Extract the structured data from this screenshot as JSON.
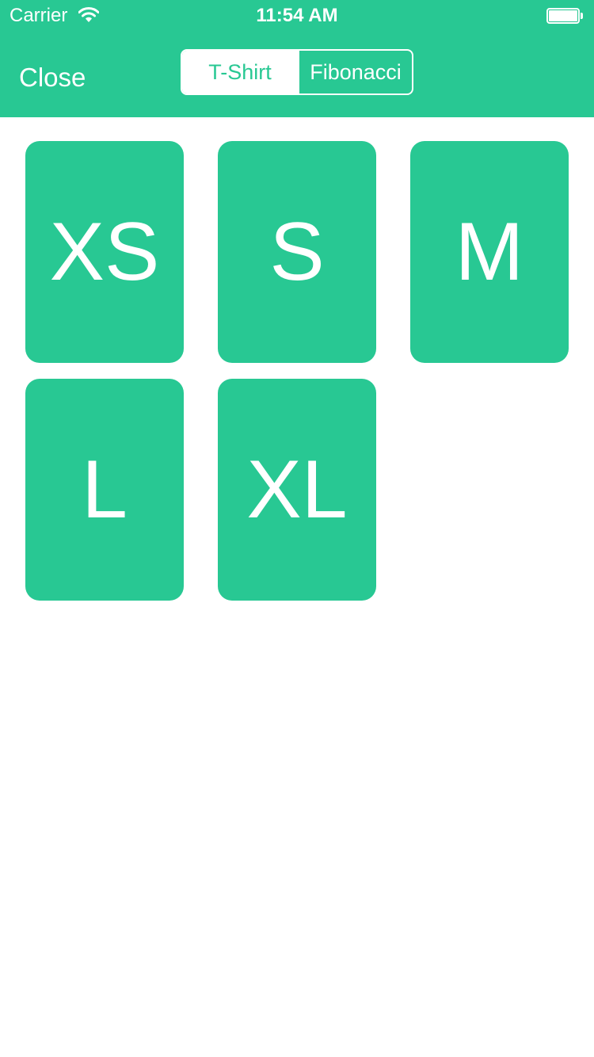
{
  "status_bar": {
    "carrier": "Carrier",
    "time": "11:54 AM",
    "battery_level": 1.0
  },
  "nav": {
    "close_label": "Close",
    "segments": [
      {
        "label": "T-Shirt",
        "selected": true
      },
      {
        "label": "Fibonacci",
        "selected": false
      }
    ]
  },
  "cards": [
    {
      "label": "XS"
    },
    {
      "label": "S"
    },
    {
      "label": "M"
    },
    {
      "label": "L"
    },
    {
      "label": "XL"
    }
  ],
  "colors": {
    "accent": "#28c893",
    "foreground": "#ffffff",
    "background": "#ffffff"
  }
}
